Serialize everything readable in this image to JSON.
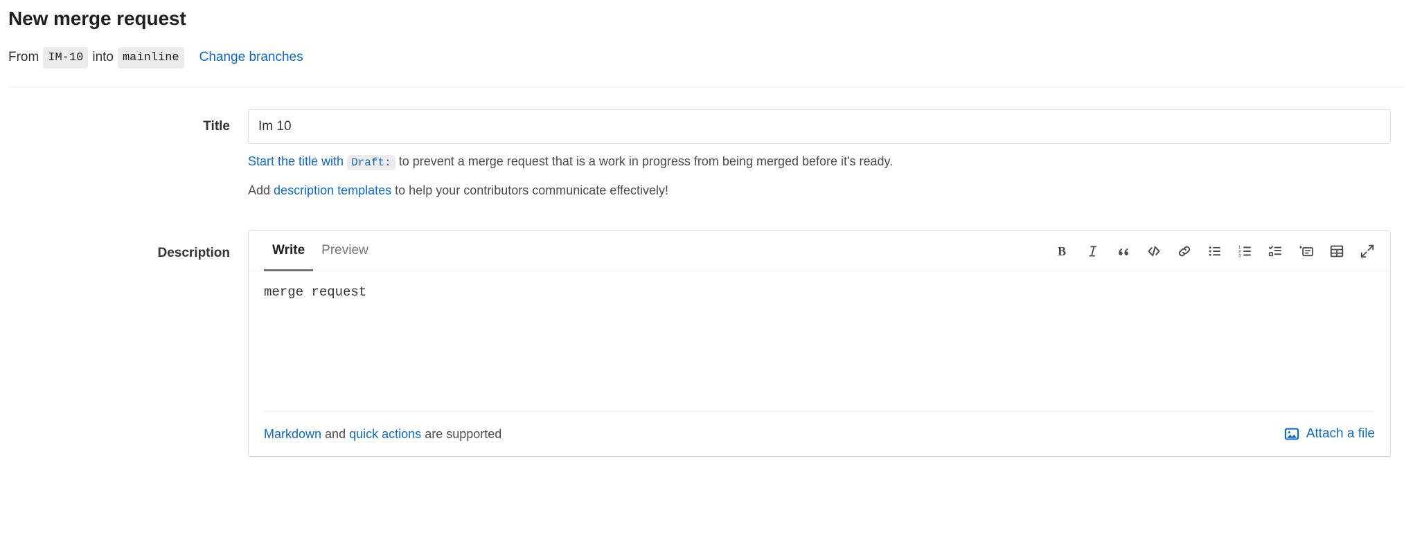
{
  "header": {
    "title": "New merge request",
    "from_word": "From",
    "source_branch": "IM-10",
    "into_word": "into",
    "target_branch": "mainline",
    "change_branches_label": "Change branches"
  },
  "title_field": {
    "label": "Title",
    "value": "Im 10",
    "placeholder": "",
    "hint1_link": "Start the title with",
    "hint1_code": "Draft:",
    "hint1_rest": "to prevent a merge request that is a work in progress from being merged before it's ready.",
    "hint2_pre": "Add",
    "hint2_link": "description templates",
    "hint2_rest": "to help your contributors communicate effectively!"
  },
  "description_field": {
    "label": "Description",
    "tabs": [
      {
        "label": "Write",
        "active": true
      },
      {
        "label": "Preview",
        "active": false
      }
    ],
    "value": "merge request",
    "placeholder": "",
    "toolbar": [
      {
        "name": "bold-icon",
        "title": "Bold"
      },
      {
        "name": "italic-icon",
        "title": "Italic"
      },
      {
        "name": "quote-icon",
        "title": "Insert a quote"
      },
      {
        "name": "code-icon",
        "title": "Insert code"
      },
      {
        "name": "link-icon",
        "title": "Add a link"
      },
      {
        "name": "bulleted-list-icon",
        "title": "Add a bullet list"
      },
      {
        "name": "numbered-list-icon",
        "title": "Add a numbered list"
      },
      {
        "name": "task-list-icon",
        "title": "Add a checklist"
      },
      {
        "name": "collapsible-section-icon",
        "title": "Add a collapsible section"
      },
      {
        "name": "table-icon",
        "title": "Add a table"
      },
      {
        "name": "fullscreen-icon",
        "title": "Go full screen"
      }
    ],
    "footer": {
      "markdown_link": "Markdown",
      "and_word": "and",
      "quick_actions_link": "quick actions",
      "supported_text": "are supported",
      "attach_label": "Attach a file",
      "attach_icon": "media-image-icon"
    }
  },
  "colors": {
    "link": "#1068bf",
    "text": "#333238",
    "muted": "#737278",
    "border": "#dcdcde",
    "badge_bg": "#ececef"
  }
}
